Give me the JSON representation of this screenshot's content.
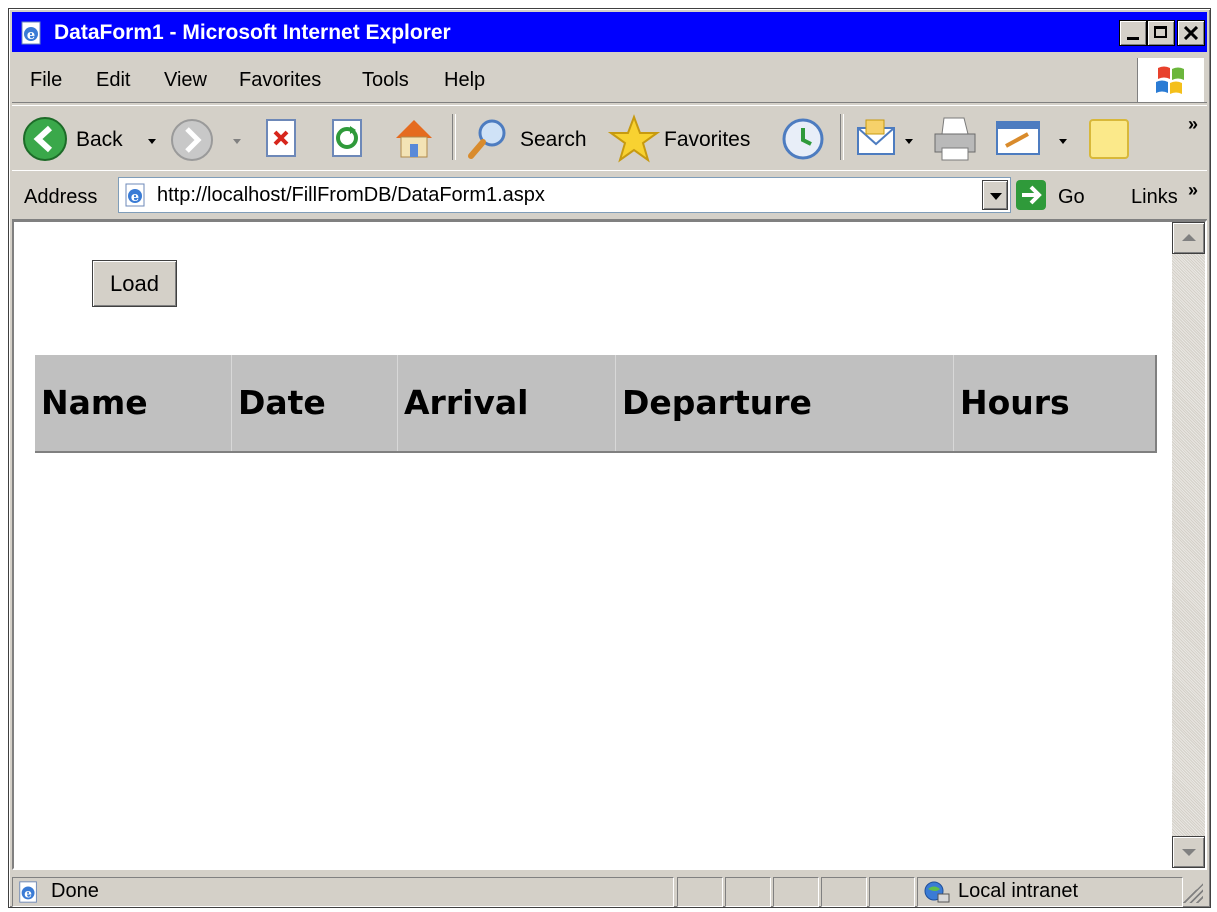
{
  "window": {
    "title": "DataForm1 - Microsoft Internet Explorer"
  },
  "menu": {
    "items": [
      "File",
      "Edit",
      "View",
      "Favorites",
      "Tools",
      "Help"
    ]
  },
  "toolbar": {
    "back_label": "Back",
    "search_label": "Search",
    "favorites_label": "Favorites",
    "overflow": "»"
  },
  "address": {
    "label": "Address",
    "url": "http://localhost/FillFromDB/DataForm1.aspx",
    "go_label": "Go",
    "links_label": "Links",
    "links_overflow": "»"
  },
  "page": {
    "load_button": "Load",
    "grid_headers": [
      "Name",
      "Date",
      "Arrival",
      "Departure",
      "Hours"
    ]
  },
  "status": {
    "text": "Done",
    "zone": "Local intranet"
  },
  "colors": {
    "titlebar": "#0000ff",
    "chrome": "#d4d0c8",
    "grid_header": "#c0c0c0"
  }
}
